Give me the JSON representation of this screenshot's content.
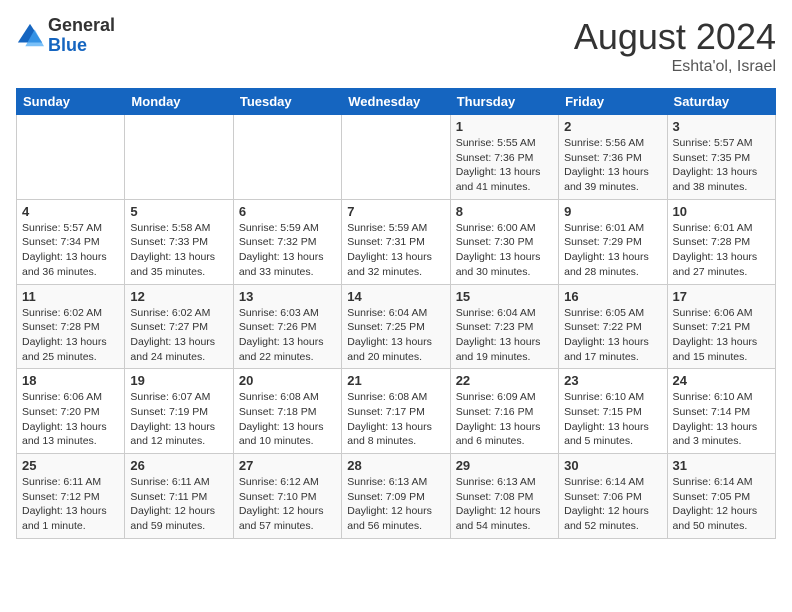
{
  "header": {
    "logo_general": "General",
    "logo_blue": "Blue",
    "month_year": "August 2024",
    "location": "Eshta'ol, Israel"
  },
  "days_of_week": [
    "Sunday",
    "Monday",
    "Tuesday",
    "Wednesday",
    "Thursday",
    "Friday",
    "Saturday"
  ],
  "weeks": [
    [
      {
        "day": "",
        "info": ""
      },
      {
        "day": "",
        "info": ""
      },
      {
        "day": "",
        "info": ""
      },
      {
        "day": "",
        "info": ""
      },
      {
        "day": "1",
        "info": "Sunrise: 5:55 AM\nSunset: 7:36 PM\nDaylight: 13 hours\nand 41 minutes."
      },
      {
        "day": "2",
        "info": "Sunrise: 5:56 AM\nSunset: 7:36 PM\nDaylight: 13 hours\nand 39 minutes."
      },
      {
        "day": "3",
        "info": "Sunrise: 5:57 AM\nSunset: 7:35 PM\nDaylight: 13 hours\nand 38 minutes."
      }
    ],
    [
      {
        "day": "4",
        "info": "Sunrise: 5:57 AM\nSunset: 7:34 PM\nDaylight: 13 hours\nand 36 minutes."
      },
      {
        "day": "5",
        "info": "Sunrise: 5:58 AM\nSunset: 7:33 PM\nDaylight: 13 hours\nand 35 minutes."
      },
      {
        "day": "6",
        "info": "Sunrise: 5:59 AM\nSunset: 7:32 PM\nDaylight: 13 hours\nand 33 minutes."
      },
      {
        "day": "7",
        "info": "Sunrise: 5:59 AM\nSunset: 7:31 PM\nDaylight: 13 hours\nand 32 minutes."
      },
      {
        "day": "8",
        "info": "Sunrise: 6:00 AM\nSunset: 7:30 PM\nDaylight: 13 hours\nand 30 minutes."
      },
      {
        "day": "9",
        "info": "Sunrise: 6:01 AM\nSunset: 7:29 PM\nDaylight: 13 hours\nand 28 minutes."
      },
      {
        "day": "10",
        "info": "Sunrise: 6:01 AM\nSunset: 7:28 PM\nDaylight: 13 hours\nand 27 minutes."
      }
    ],
    [
      {
        "day": "11",
        "info": "Sunrise: 6:02 AM\nSunset: 7:28 PM\nDaylight: 13 hours\nand 25 minutes."
      },
      {
        "day": "12",
        "info": "Sunrise: 6:02 AM\nSunset: 7:27 PM\nDaylight: 13 hours\nand 24 minutes."
      },
      {
        "day": "13",
        "info": "Sunrise: 6:03 AM\nSunset: 7:26 PM\nDaylight: 13 hours\nand 22 minutes."
      },
      {
        "day": "14",
        "info": "Sunrise: 6:04 AM\nSunset: 7:25 PM\nDaylight: 13 hours\nand 20 minutes."
      },
      {
        "day": "15",
        "info": "Sunrise: 6:04 AM\nSunset: 7:23 PM\nDaylight: 13 hours\nand 19 minutes."
      },
      {
        "day": "16",
        "info": "Sunrise: 6:05 AM\nSunset: 7:22 PM\nDaylight: 13 hours\nand 17 minutes."
      },
      {
        "day": "17",
        "info": "Sunrise: 6:06 AM\nSunset: 7:21 PM\nDaylight: 13 hours\nand 15 minutes."
      }
    ],
    [
      {
        "day": "18",
        "info": "Sunrise: 6:06 AM\nSunset: 7:20 PM\nDaylight: 13 hours\nand 13 minutes."
      },
      {
        "day": "19",
        "info": "Sunrise: 6:07 AM\nSunset: 7:19 PM\nDaylight: 13 hours\nand 12 minutes."
      },
      {
        "day": "20",
        "info": "Sunrise: 6:08 AM\nSunset: 7:18 PM\nDaylight: 13 hours\nand 10 minutes."
      },
      {
        "day": "21",
        "info": "Sunrise: 6:08 AM\nSunset: 7:17 PM\nDaylight: 13 hours\nand 8 minutes."
      },
      {
        "day": "22",
        "info": "Sunrise: 6:09 AM\nSunset: 7:16 PM\nDaylight: 13 hours\nand 6 minutes."
      },
      {
        "day": "23",
        "info": "Sunrise: 6:10 AM\nSunset: 7:15 PM\nDaylight: 13 hours\nand 5 minutes."
      },
      {
        "day": "24",
        "info": "Sunrise: 6:10 AM\nSunset: 7:14 PM\nDaylight: 13 hours\nand 3 minutes."
      }
    ],
    [
      {
        "day": "25",
        "info": "Sunrise: 6:11 AM\nSunset: 7:12 PM\nDaylight: 13 hours\nand 1 minute."
      },
      {
        "day": "26",
        "info": "Sunrise: 6:11 AM\nSunset: 7:11 PM\nDaylight: 12 hours\nand 59 minutes."
      },
      {
        "day": "27",
        "info": "Sunrise: 6:12 AM\nSunset: 7:10 PM\nDaylight: 12 hours\nand 57 minutes."
      },
      {
        "day": "28",
        "info": "Sunrise: 6:13 AM\nSunset: 7:09 PM\nDaylight: 12 hours\nand 56 minutes."
      },
      {
        "day": "29",
        "info": "Sunrise: 6:13 AM\nSunset: 7:08 PM\nDaylight: 12 hours\nand 54 minutes."
      },
      {
        "day": "30",
        "info": "Sunrise: 6:14 AM\nSunset: 7:06 PM\nDaylight: 12 hours\nand 52 minutes."
      },
      {
        "day": "31",
        "info": "Sunrise: 6:14 AM\nSunset: 7:05 PM\nDaylight: 12 hours\nand 50 minutes."
      }
    ]
  ]
}
